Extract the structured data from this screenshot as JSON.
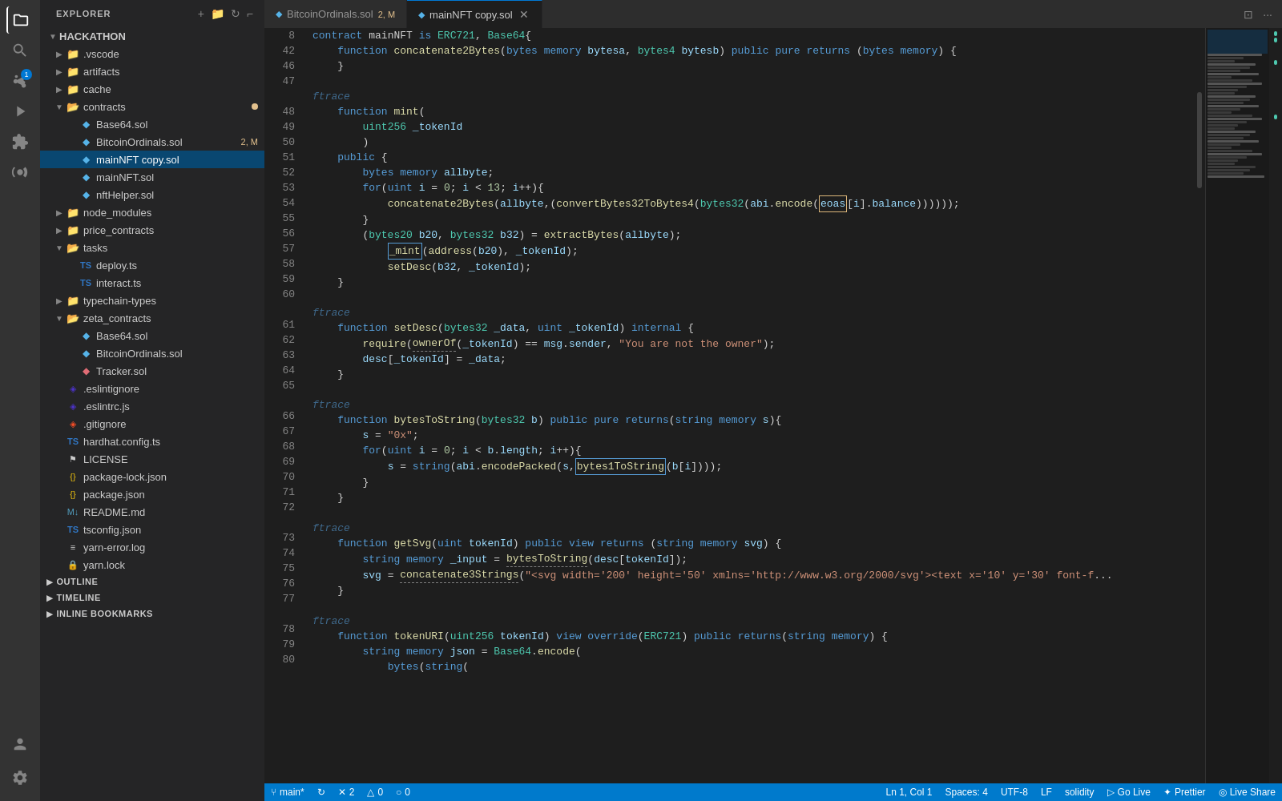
{
  "activityBar": {
    "icons": [
      {
        "name": "files-icon",
        "symbol": "⎘",
        "active": true,
        "badge": null
      },
      {
        "name": "search-icon",
        "symbol": "🔍",
        "active": false,
        "badge": null
      },
      {
        "name": "source-control-icon",
        "symbol": "⑂",
        "active": false,
        "badge": "1"
      },
      {
        "name": "run-icon",
        "symbol": "▷",
        "active": false,
        "badge": null
      },
      {
        "name": "extensions-icon",
        "symbol": "⊞",
        "active": false,
        "badge": null
      },
      {
        "name": "remote-icon",
        "symbol": "◎",
        "active": false,
        "badge": null
      }
    ],
    "bottomIcons": [
      {
        "name": "account-icon",
        "symbol": "👤"
      },
      {
        "name": "settings-icon",
        "symbol": "⚙"
      }
    ]
  },
  "sidebar": {
    "header": "EXPLORER",
    "root": "HACKATHON",
    "items": [
      {
        "id": "vscode",
        "label": ".vscode",
        "type": "folder",
        "indent": 1,
        "expanded": false
      },
      {
        "id": "artifacts",
        "label": "artifacts",
        "type": "folder",
        "indent": 1,
        "expanded": false
      },
      {
        "id": "cache",
        "label": "cache",
        "type": "folder",
        "indent": 1,
        "expanded": false
      },
      {
        "id": "contracts",
        "label": "contracts",
        "type": "folder",
        "indent": 1,
        "expanded": true,
        "dirty": true
      },
      {
        "id": "Base64-contracts",
        "label": "Base64.sol",
        "type": "sol",
        "indent": 2
      },
      {
        "id": "BitcoinOrdinals-contracts",
        "label": "BitcoinOrdinals.sol",
        "type": "sol",
        "indent": 2,
        "badge": "2, M"
      },
      {
        "id": "mainNFT-copy",
        "label": "mainNFT copy.sol",
        "type": "sol",
        "indent": 2,
        "active": true
      },
      {
        "id": "mainNFT",
        "label": "mainNFT.sol",
        "type": "sol",
        "indent": 2
      },
      {
        "id": "nftHelper",
        "label": "nftHelper.sol",
        "type": "sol",
        "indent": 2
      },
      {
        "id": "node_modules",
        "label": "node_modules",
        "type": "folder",
        "indent": 1,
        "expanded": false
      },
      {
        "id": "price_contracts",
        "label": "price_contracts",
        "type": "folder",
        "indent": 1,
        "expanded": false
      },
      {
        "id": "tasks",
        "label": "tasks",
        "type": "folder",
        "indent": 1,
        "expanded": true
      },
      {
        "id": "deploy",
        "label": "deploy.ts",
        "type": "ts",
        "indent": 2
      },
      {
        "id": "interact",
        "label": "interact.ts",
        "type": "ts",
        "indent": 2
      },
      {
        "id": "typechain-types",
        "label": "typechain-types",
        "type": "folder",
        "indent": 1,
        "expanded": false
      },
      {
        "id": "zeta_contracts",
        "label": "zeta_contracts",
        "type": "folder",
        "indent": 1,
        "expanded": true
      },
      {
        "id": "Base64-zeta",
        "label": "Base64.sol",
        "type": "sol",
        "indent": 2
      },
      {
        "id": "BitcoinOrdinals-zeta",
        "label": "BitcoinOrdinals.sol",
        "type": "sol",
        "indent": 2
      },
      {
        "id": "Tracker",
        "label": "Tracker.sol",
        "type": "sol-orange",
        "indent": 2
      },
      {
        "id": "eslintignore",
        "label": ".eslintignore",
        "type": "eslint",
        "indent": 1
      },
      {
        "id": "eslintrc",
        "label": ".eslintrc.js",
        "type": "eslint",
        "indent": 1
      },
      {
        "id": "gitignore",
        "label": ".gitignore",
        "type": "git",
        "indent": 1
      },
      {
        "id": "hardhat",
        "label": "hardhat.config.ts",
        "type": "ts",
        "indent": 1
      },
      {
        "id": "license",
        "label": "LICENSE",
        "type": "license",
        "indent": 1
      },
      {
        "id": "package-lock",
        "label": "package-lock.json",
        "type": "json",
        "indent": 1
      },
      {
        "id": "package",
        "label": "package.json",
        "type": "json",
        "indent": 1
      },
      {
        "id": "readme",
        "label": "README.md",
        "type": "md",
        "indent": 1
      },
      {
        "id": "tsconfig",
        "label": "tsconfig.json",
        "type": "ts",
        "indent": 1
      },
      {
        "id": "yarn-error",
        "label": "yarn-error.log",
        "type": "log",
        "indent": 1
      },
      {
        "id": "yarn-lock",
        "label": "yarn.lock",
        "type": "yarn",
        "indent": 1
      }
    ],
    "sections": [
      {
        "id": "outline",
        "label": "OUTLINE",
        "expanded": false
      },
      {
        "id": "timeline",
        "label": "TIMELINE",
        "expanded": false
      },
      {
        "id": "inline-bookmarks",
        "label": "INLINE BOOKMARKS",
        "expanded": false
      }
    ]
  },
  "tabs": [
    {
      "id": "bitcoin-tab",
      "label": "BitcoinOrdinals.sol",
      "badge": "2, M",
      "active": false,
      "dirty": false
    },
    {
      "id": "mainnft-tab",
      "label": "mainNFT copy.sol",
      "badge": null,
      "active": true,
      "dirty": false
    }
  ],
  "editor": {
    "filename": "mainNFT copy.sol",
    "lines": [
      {
        "num": 8,
        "content": "contract mainNFT is ERC721, Base64{"
      },
      {
        "num": 42,
        "content": "function concatenate2Bytes(bytes memory bytesa, bytes4 bytesb) public pure returns (bytes memory) {"
      },
      {
        "num": 46,
        "content": "    }"
      },
      {
        "num": 47,
        "content": ""
      },
      {
        "num": "",
        "content": "ftrace",
        "type": "trace"
      },
      {
        "num": 48,
        "content": "    function mint("
      },
      {
        "num": 49,
        "content": "        uint256 _tokenId"
      },
      {
        "num": 50,
        "content": "        )"
      },
      {
        "num": 51,
        "content": "    public {"
      },
      {
        "num": 52,
        "content": "        bytes memory allbyte;"
      },
      {
        "num": 53,
        "content": "        for(uint i = 0; i < 13; i++){"
      },
      {
        "num": 54,
        "content": "            concatenate2Bytes(allbyte,(convertBytes32ToBytes4(bytes32(abi.encode(eoas[i].balance)))));"
      },
      {
        "num": 55,
        "content": "        }"
      },
      {
        "num": 56,
        "content": "        (bytes20 b20, bytes32 b32) = extractBytes(allbyte);"
      },
      {
        "num": 57,
        "content": "            _mint(address(b20), _tokenId);"
      },
      {
        "num": 58,
        "content": "            setDesc(b32, _tokenId);"
      },
      {
        "num": 59,
        "content": "    }"
      },
      {
        "num": 60,
        "content": ""
      },
      {
        "num": "",
        "content": "ftrace",
        "type": "trace"
      },
      {
        "num": 61,
        "content": "    function setDesc(bytes32 _data, uint _tokenId) internal {"
      },
      {
        "num": 62,
        "content": "        require(ownerOf(_tokenId) == msg.sender, \"You are not the owner\");"
      },
      {
        "num": 63,
        "content": "        desc[_tokenId] = _data;"
      },
      {
        "num": 64,
        "content": "    }"
      },
      {
        "num": 65,
        "content": ""
      },
      {
        "num": "",
        "content": "ftrace",
        "type": "trace"
      },
      {
        "num": 66,
        "content": "    function bytesToString(bytes32 b) public pure returns(string memory s){"
      },
      {
        "num": 67,
        "content": "        s = \"0x\";"
      },
      {
        "num": 68,
        "content": "        for(uint i = 0; i < b.length; i++){"
      },
      {
        "num": 69,
        "content": "            s = string(abi.encodePacked(s,bytes1ToString(b[i])));"
      },
      {
        "num": 70,
        "content": "        }"
      },
      {
        "num": 71,
        "content": "    }"
      },
      {
        "num": 72,
        "content": ""
      },
      {
        "num": "",
        "content": "ftrace",
        "type": "trace"
      },
      {
        "num": 73,
        "content": "    function getSvg(uint tokenId) public view returns (string memory svg) {"
      },
      {
        "num": 74,
        "content": "        string memory _input = bytesToString(desc[tokenId]);"
      },
      {
        "num": 75,
        "content": "        svg = concatenate3Strings(\"<svg width='200' height='50' xmlns='http://www.w3.org/2000/svg'><text x='10' y='30' font-f"
      },
      {
        "num": 76,
        "content": "    }"
      },
      {
        "num": 77,
        "content": ""
      },
      {
        "num": "",
        "content": "ftrace",
        "type": "trace"
      },
      {
        "num": 78,
        "content": "    function tokenURI(uint256 tokenId) view override(ERC721) public returns(string memory) {"
      },
      {
        "num": 79,
        "content": "        string memory json = Base64.encode("
      },
      {
        "num": 80,
        "content": "            bytes(string("
      }
    ]
  },
  "statusBar": {
    "left": [
      {
        "id": "branch",
        "icon": "⑂",
        "label": "main*"
      },
      {
        "id": "sync",
        "icon": "↻",
        "label": ""
      },
      {
        "id": "errors",
        "icon": "✕",
        "label": "2"
      },
      {
        "id": "warnings",
        "icon": "△",
        "label": "0"
      },
      {
        "id": "info",
        "icon": "○",
        "label": "0"
      }
    ],
    "right": [
      {
        "id": "position",
        "label": "Ln 1, Col 1"
      },
      {
        "id": "spaces",
        "label": "Spaces: 4"
      },
      {
        "id": "encoding",
        "label": "UTF-8"
      },
      {
        "id": "eol",
        "label": "LF"
      },
      {
        "id": "language",
        "label": "solidity"
      },
      {
        "id": "golive",
        "icon": "▷",
        "label": "Go Live"
      },
      {
        "id": "prettier",
        "icon": "✦",
        "label": "Prettier"
      },
      {
        "id": "liveshare",
        "icon": "◎",
        "label": "Live Share"
      }
    ]
  }
}
